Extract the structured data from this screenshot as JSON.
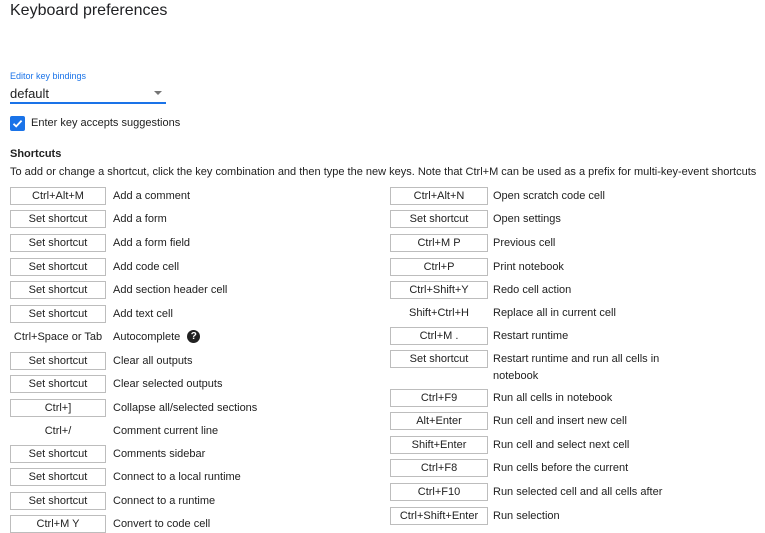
{
  "page": {
    "title": "Keyboard preferences",
    "bindings_label": "Editor key bindings",
    "bindings_value": "default",
    "enter_key_label": "Enter key accepts suggestions",
    "enter_key_checked": true,
    "shortcuts_title": "Shortcuts",
    "hint": "To add or change a shortcut, click the key combination and then type the new keys. Note that Ctrl+M can be used as a prefix for multi-key-event shortcuts"
  },
  "left": [
    {
      "key": "Ctrl+Alt+M",
      "desc": "Add a comment"
    },
    {
      "key": "Set shortcut",
      "desc": "Add a form"
    },
    {
      "key": "Set shortcut",
      "desc": "Add a form field"
    },
    {
      "key": "Set shortcut",
      "desc": "Add code cell"
    },
    {
      "key": "Set shortcut",
      "desc": "Add section header cell"
    },
    {
      "key": "Set shortcut",
      "desc": "Add text cell"
    },
    {
      "key": "Ctrl+Space or Tab",
      "desc": "Autocomplete",
      "help": "?"
    },
    {
      "key": "Set shortcut",
      "desc": "Clear all outputs"
    },
    {
      "key": "Set shortcut",
      "desc": "Clear selected outputs"
    },
    {
      "key": "Ctrl+]",
      "desc": "Collapse all/selected sections"
    },
    {
      "key": "Ctrl+/",
      "desc": "Comment current line"
    },
    {
      "key": "Set shortcut",
      "desc": "Comments sidebar"
    },
    {
      "key": "Set shortcut",
      "desc": "Connect to a local runtime"
    },
    {
      "key": "Set shortcut",
      "desc": "Connect to a runtime"
    },
    {
      "key": "Ctrl+M Y",
      "desc": "Convert to code cell"
    }
  ],
  "right": [
    {
      "key": "Ctrl+Alt+N",
      "desc": "Open scratch code cell"
    },
    {
      "key": "Set shortcut",
      "desc": "Open settings"
    },
    {
      "key": "Ctrl+M P",
      "desc": "Previous cell"
    },
    {
      "key": "Ctrl+P",
      "desc": "Print notebook"
    },
    {
      "key": "Ctrl+Shift+Y",
      "desc": "Redo cell action"
    },
    {
      "key": "Shift+Ctrl+H",
      "desc": "Replace all in current cell"
    },
    {
      "key": "Ctrl+M .",
      "desc": "Restart runtime"
    },
    {
      "key": "Set shortcut",
      "desc": "Restart runtime and run all cells in notebook"
    },
    {
      "key": "Ctrl+F9",
      "desc": "Run all cells in notebook"
    },
    {
      "key": "Alt+Enter",
      "desc": "Run cell and insert new cell"
    },
    {
      "key": "Shift+Enter",
      "desc": "Run cell and select next cell"
    },
    {
      "key": "Ctrl+F8",
      "desc": "Run cells before the current"
    },
    {
      "key": "Ctrl+F10",
      "desc": "Run selected cell and all cells after"
    },
    {
      "key": "Ctrl+Shift+Enter",
      "desc": "Run selection"
    }
  ]
}
